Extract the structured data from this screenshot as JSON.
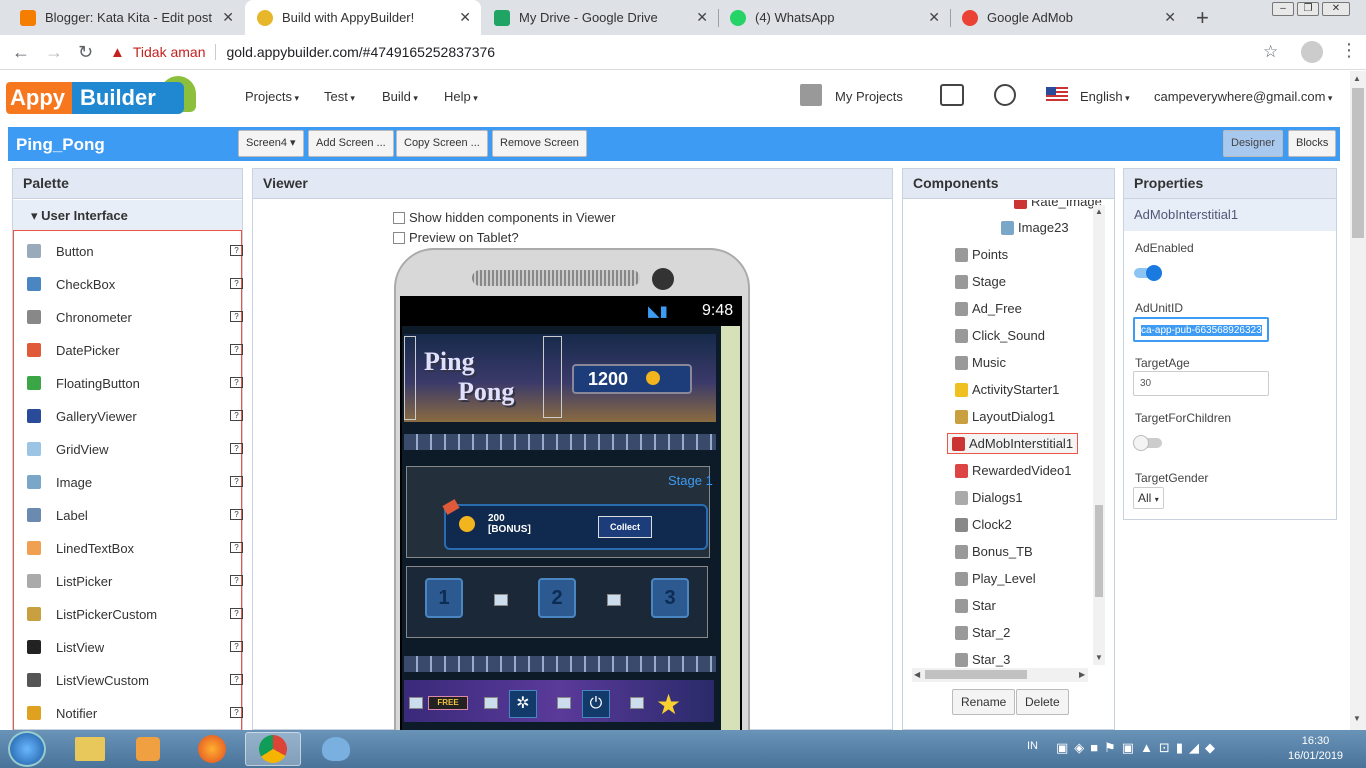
{
  "browser": {
    "tabs": [
      {
        "title": "Blogger: Kata Kita - Edit post",
        "color": "#f57d00"
      },
      {
        "title": "Build with AppyBuilder!",
        "color": "#e8b62a"
      },
      {
        "title": "My Drive - Google Drive",
        "color": "#1fa463"
      },
      {
        "title": "(4) WhatsApp",
        "color": "#25d366"
      },
      {
        "title": "Google AdMob",
        "color": "#ea4335"
      }
    ],
    "security_label": "Tidak aman",
    "url": "gold.appybuilder.com/#4749165252837376"
  },
  "app": {
    "logo_left": "Appy",
    "logo_right": "Builder",
    "menus": [
      "Projects",
      "Test",
      "Build",
      "Help"
    ],
    "my_projects": "My Projects",
    "language": "English",
    "account": "campeverywhere@gmail.com"
  },
  "toolbar": {
    "project_name": "Ping_Pong",
    "screen_select": "Screen4",
    "add_screen": "Add Screen ...",
    "copy_screen": "Copy Screen ...",
    "remove_screen": "Remove Screen",
    "designer": "Designer",
    "blocks": "Blocks"
  },
  "palette": {
    "title": "Palette",
    "group": "User Interface",
    "items": [
      {
        "label": "Button",
        "color": "#9ab"
      },
      {
        "label": "CheckBox",
        "color": "#4a86c2"
      },
      {
        "label": "Chronometer",
        "color": "#888"
      },
      {
        "label": "DatePicker",
        "color": "#e05a3a"
      },
      {
        "label": "FloatingButton",
        "color": "#3aa645"
      },
      {
        "label": "GalleryViewer",
        "color": "#2a4a9a"
      },
      {
        "label": "GridView",
        "color": "#9cc4e4"
      },
      {
        "label": "Image",
        "color": "#7aa6c8"
      },
      {
        "label": "Label",
        "color": "#6a8ab0"
      },
      {
        "label": "LinedTextBox",
        "color": "#f0a050"
      },
      {
        "label": "ListPicker",
        "color": "#aaa"
      },
      {
        "label": "ListPickerCustom",
        "color": "#c8a040"
      },
      {
        "label": "ListView",
        "color": "#222"
      },
      {
        "label": "ListViewCustom",
        "color": "#555"
      },
      {
        "label": "Notifier",
        "color": "#e0a020"
      }
    ]
  },
  "viewer": {
    "title": "Viewer",
    "show_hidden": "Show hidden components in Viewer",
    "preview_tablet": "Preview on Tablet?",
    "phone_time": "9:48",
    "game": {
      "title_line1": "Ping",
      "title_line2": "Pong",
      "score": "1200",
      "stage": "Stage 1",
      "bonus_amount": "200",
      "bonus_label": "[BONUS]",
      "collect": "Collect",
      "levels": [
        "1",
        "2",
        "3"
      ],
      "free": "FREE"
    }
  },
  "components": {
    "title": "Components",
    "items": [
      {
        "label": "Rate_Image",
        "color": "#c33"
      },
      {
        "label": "Image23",
        "color": "#7aa6c8"
      },
      {
        "label": "Points",
        "color": "#999"
      },
      {
        "label": "Stage",
        "color": "#999"
      },
      {
        "label": "Ad_Free",
        "color": "#999"
      },
      {
        "label": "Click_Sound",
        "color": "#999"
      },
      {
        "label": "Music",
        "color": "#999"
      },
      {
        "label": "ActivityStarter1",
        "color": "#f0c020"
      },
      {
        "label": "LayoutDialog1",
        "color": "#c8a040"
      },
      {
        "label": "AdMobInterstitial1",
        "color": "#c33"
      },
      {
        "label": "RewardedVideo1",
        "color": "#d44"
      },
      {
        "label": "Dialogs1",
        "color": "#aaa"
      },
      {
        "label": "Clock2",
        "color": "#888"
      },
      {
        "label": "Bonus_TB",
        "color": "#999"
      },
      {
        "label": "Play_Level",
        "color": "#999"
      },
      {
        "label": "Star",
        "color": "#999"
      },
      {
        "label": "Star_2",
        "color": "#999"
      },
      {
        "label": "Star_3",
        "color": "#999"
      }
    ],
    "selected": "AdMobInterstitial1",
    "rename": "Rename",
    "delete": "Delete"
  },
  "properties": {
    "title": "Properties",
    "component": "AdMobInterstitial1",
    "ad_enabled_label": "AdEnabled",
    "ad_enabled": true,
    "ad_unit_label": "AdUnitID",
    "ad_unit_value": "ca-app-pub-663568926323",
    "target_age_label": "TargetAge",
    "target_age_value": "30",
    "target_children_label": "TargetForChildren",
    "target_children": false,
    "target_gender_label": "TargetGender",
    "target_gender_value": "All"
  },
  "taskbar": {
    "lang": "IN",
    "time": "16:30",
    "date": "16/01/2019"
  },
  "colors": {
    "accent_blue": "#3d9bf3",
    "appy_orange": "#f7771e",
    "builder_blue": "#1f88d0",
    "selection_red": "#e54"
  }
}
